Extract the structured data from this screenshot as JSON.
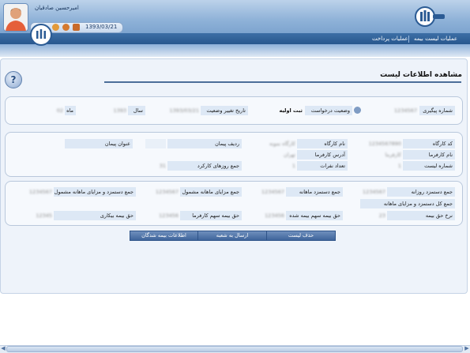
{
  "header": {
    "user_name": "امیرحسین صادقیان",
    "date": "1393/03/21",
    "menu": [
      "عملیات لیست بیمه",
      "عملیات پرداخت"
    ]
  },
  "page": {
    "title": "مشاهده اطلاعات لیست",
    "help_label": "?"
  },
  "status_panel": {
    "tracking_label": "شماره پیگیری",
    "tracking_value": "1234567",
    "request_status_label": "وضعیت درخواست",
    "request_status_value": "ثبت اولیه",
    "status_change_date_label": "تاریخ تغییر وضعیت",
    "status_change_date_value": "1393/03/21",
    "year_label": "سال",
    "year_value": "1393",
    "month_label": "ماه",
    "month_value": "02"
  },
  "workshop_panel": {
    "workshop_code_label": "کد کارگاه",
    "workshop_code_value": "1234567890",
    "workshop_name_label": "نام کارگاه",
    "workshop_name_value": "کارگاه نمونه",
    "contract_row_label": "ردیف پیمان",
    "contract_title_label": "عنوان پیمان",
    "employer_name_label": "نام کارفرما",
    "employer_name_value": "کارفرما",
    "employer_address_label": "آدرس کارفرما",
    "employer_address_value": "تهران",
    "list_number_label": "شماره لیست",
    "list_number_value": "1",
    "people_count_label": "تعداد نفرات",
    "people_count_value": "1",
    "work_days_label": "جمع روزهای کارکرد",
    "work_days_value": "31"
  },
  "totals_panel": {
    "daily_wage_label": "جمع دستمزد روزانه",
    "daily_wage_value": "1234567",
    "monthly_wage_label": "جمع دستمزد ماهانه",
    "monthly_wage_value": "1234567",
    "monthly_benefits_label": "جمع مزایای ماهانه مشمول",
    "monthly_benefits_value": "1234567",
    "wage_benefits_label": "جمع دستمزد و مزایای ماهانه مشمول",
    "wage_benefits_value": "1234567",
    "total_wage_benefits_label": "جمع کل دستمزد و مزایای ماهانه",
    "insurance_rate_label": "نرخ حق بیمه",
    "insurance_rate_value": "23",
    "insured_share_label": "حق بیمه سهم بیمه شده",
    "insured_share_value": "123456",
    "employer_share_label": "حق بیمه سهم کارفرما",
    "employer_share_value": "123456",
    "unemployment_label": "حق بیمه بیکاری",
    "unemployment_value": "12345"
  },
  "actions": [
    "حذف لیست",
    "ارسال به شعبه",
    "اطلاعات بیمه شدگان"
  ],
  "colors": {
    "header": "#8fb2d8",
    "menu_bar": "#28578e",
    "panel_label": "#dde8f5",
    "button": "#3f659b"
  },
  "icons": [
    "avatar-icon",
    "help-icon",
    "info-icon",
    "lock-icon",
    "mail-icon"
  ]
}
